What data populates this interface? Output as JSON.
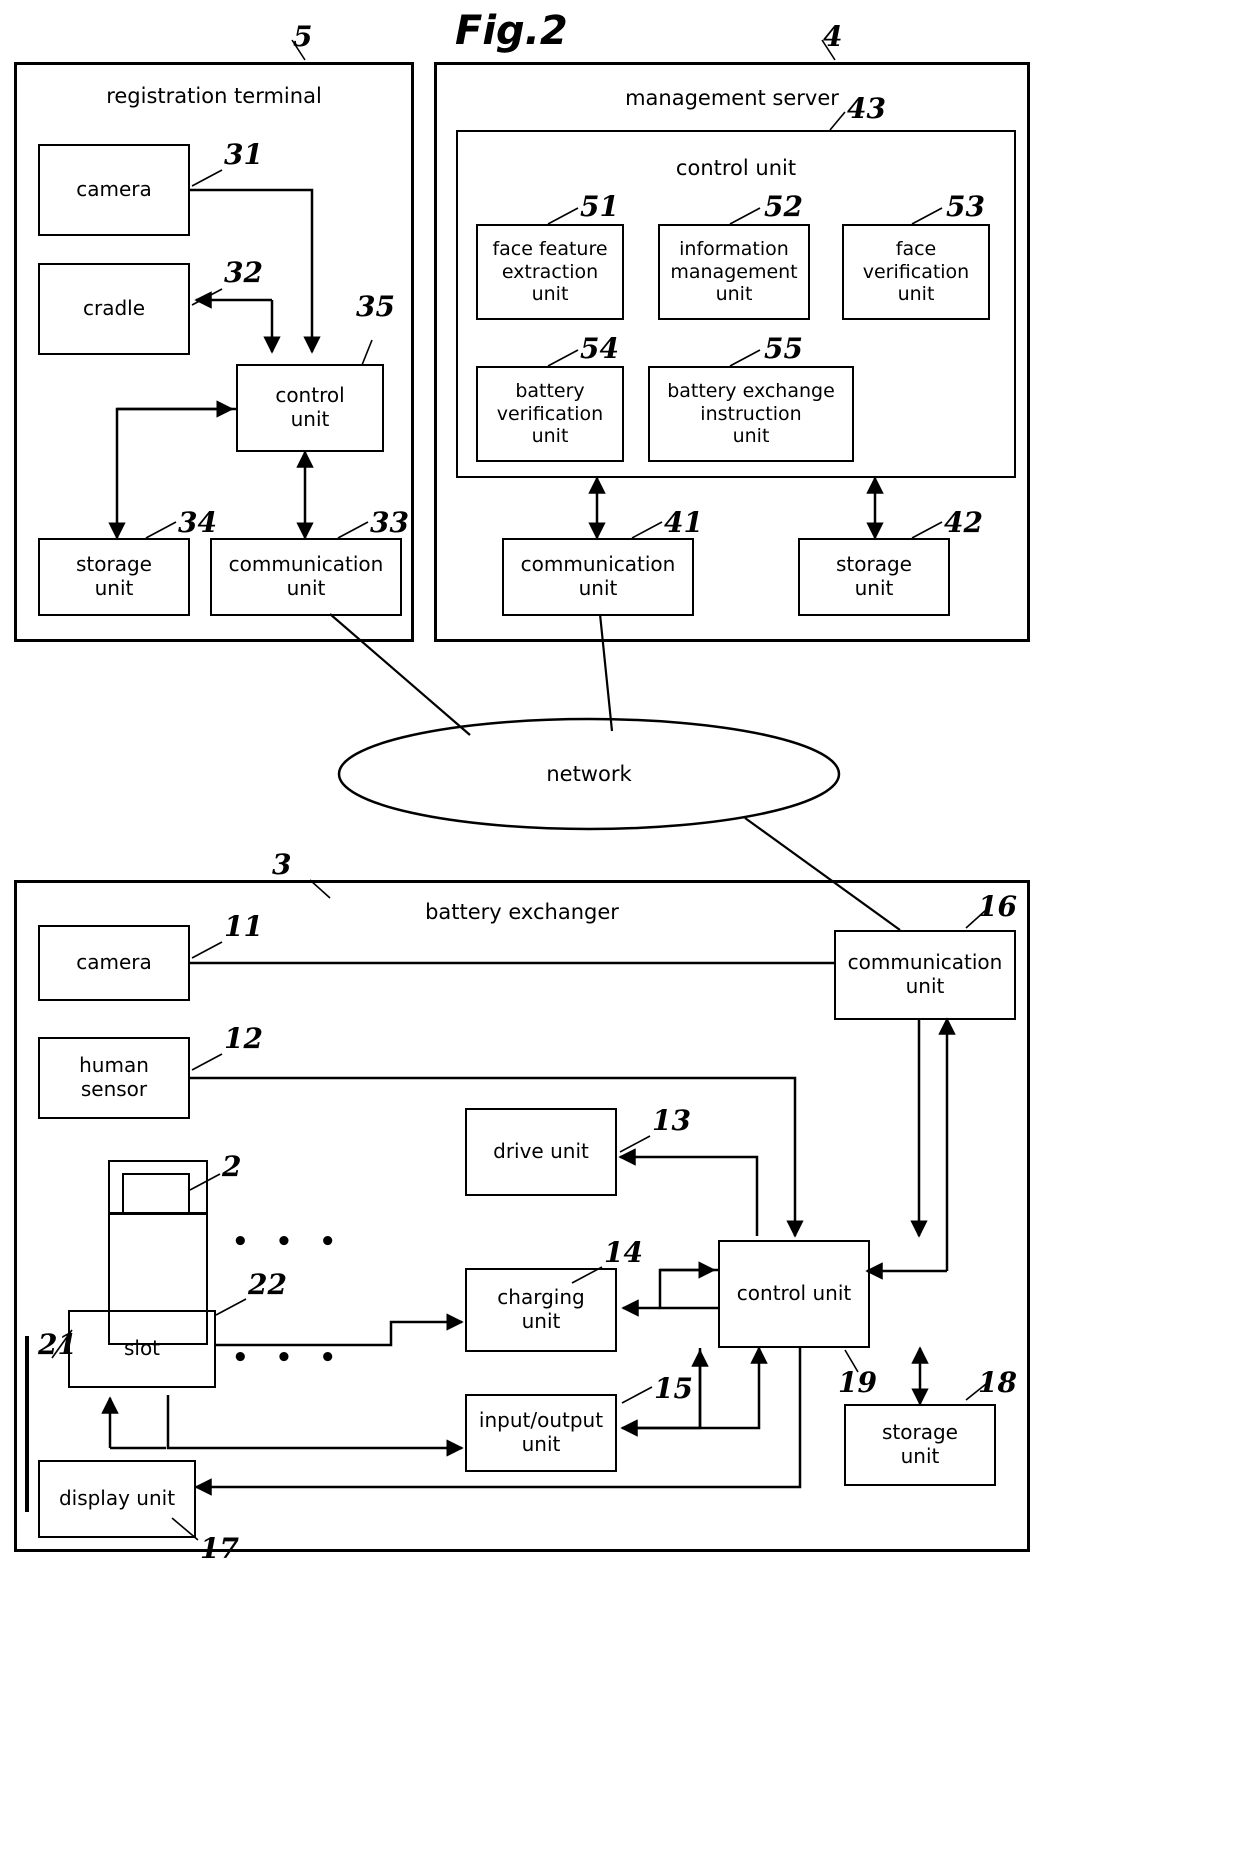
{
  "figure": {
    "title": "Fig.2"
  },
  "panels": {
    "registration_terminal": {
      "title": "registration terminal",
      "ref": "5",
      "blocks": {
        "camera": {
          "label": "camera",
          "ref": "31"
        },
        "cradle": {
          "label": "cradle",
          "ref": "32"
        },
        "control_unit": {
          "label": "control\nunit",
          "ref": "35"
        },
        "storage_unit": {
          "label": "storage\nunit",
          "ref": "34"
        },
        "communication_unit": {
          "label": "communication\nunit",
          "ref": "33"
        }
      }
    },
    "management_server": {
      "title": "management server",
      "ref": "4",
      "control_unit": {
        "title": "control unit",
        "ref": "43",
        "blocks": {
          "face_feature_extraction_unit": {
            "label": "face feature\nextraction\nunit",
            "ref": "51"
          },
          "information_management_unit": {
            "label": "information\nmanagement\nunit",
            "ref": "52"
          },
          "face_verification_unit": {
            "label": "face\nverification\nunit",
            "ref": "53"
          },
          "battery_verification_unit": {
            "label": "battery\nverification\nunit",
            "ref": "54"
          },
          "battery_exchange_instruction_unit": {
            "label": "battery exchange\ninstruction\nunit",
            "ref": "55"
          }
        }
      },
      "blocks": {
        "communication_unit": {
          "label": "communication\nunit",
          "ref": "41"
        },
        "storage_unit": {
          "label": "storage\nunit",
          "ref": "42"
        }
      }
    },
    "network": {
      "label": "network"
    },
    "battery_exchanger": {
      "title": "battery exchanger",
      "ref": "3",
      "blocks": {
        "camera": {
          "label": "camera",
          "ref": "11"
        },
        "human_sensor": {
          "label": "human\nsensor",
          "ref": "12"
        },
        "drive_unit": {
          "label": "drive unit",
          "ref": "13"
        },
        "charging_unit": {
          "label": "charging\nunit",
          "ref": "14"
        },
        "input_output_unit": {
          "label": "input/output\nunit",
          "ref": "15"
        },
        "communication_unit": {
          "label": "communication\nunit",
          "ref": "16"
        },
        "display_unit": {
          "label": "display unit",
          "ref": "17"
        },
        "storage_unit": {
          "label": "storage\nunit",
          "ref": "18"
        },
        "control_unit": {
          "label": "control unit",
          "ref": "19"
        },
        "battery": {
          "label": "",
          "ref": "2"
        },
        "slot": {
          "label": "slot",
          "ref": "22"
        },
        "rack": {
          "label": "",
          "ref": "21"
        }
      },
      "ellipsis_upper": "• • •",
      "ellipsis_lower": "• • •"
    }
  }
}
